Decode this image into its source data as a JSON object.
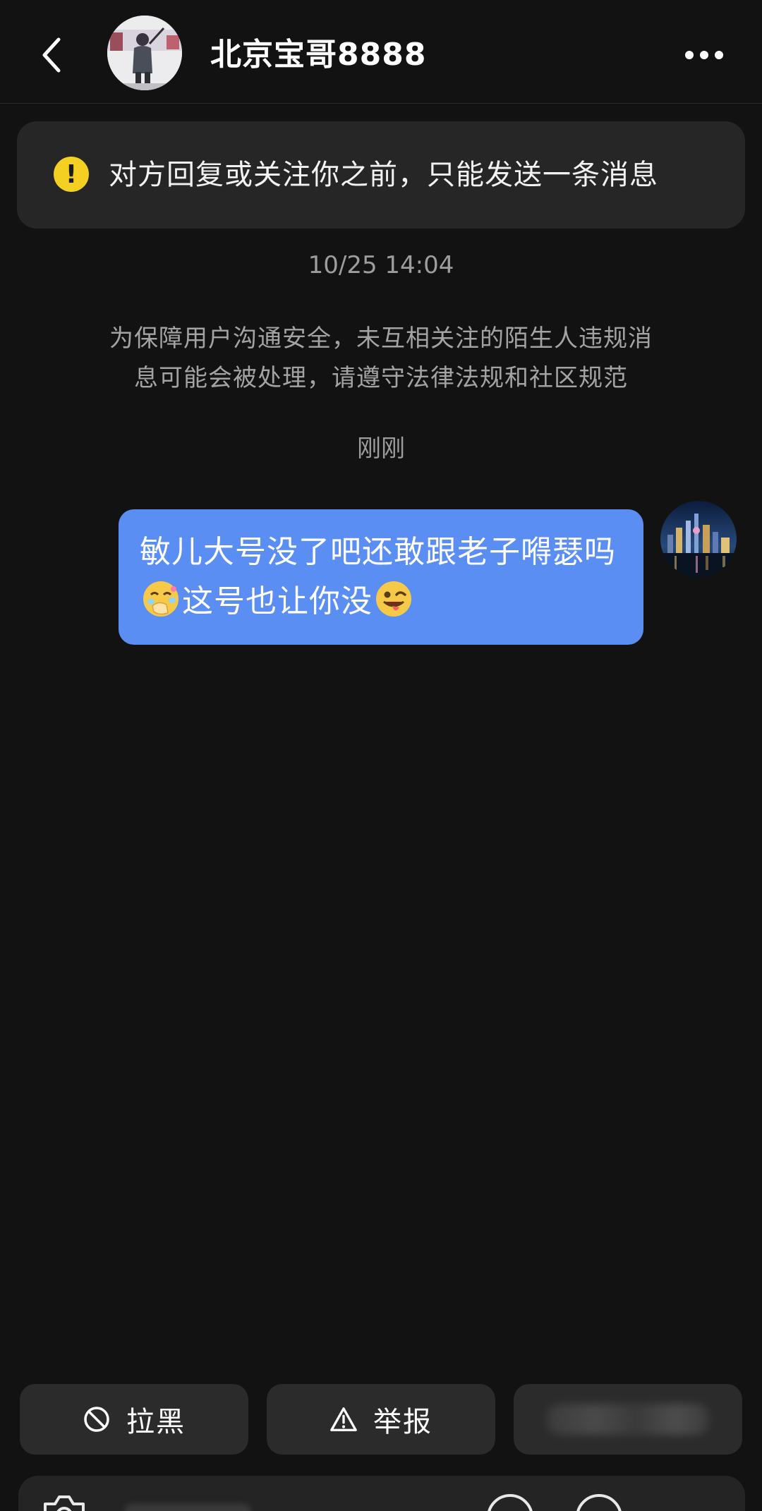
{
  "header": {
    "contact_name": "北京宝哥8888",
    "back_icon": "chevron-left-icon",
    "more_icon": "more-dots-icon"
  },
  "notice": {
    "text": "对方回复或关注你之前，只能发送一条消息",
    "icon": "warning-icon",
    "icon_glyph": "!",
    "icon_color": "#f4d023"
  },
  "chat": {
    "timestamp_1": "10/25 14:04",
    "system_message": "为保障用户沟通安全，未互相关注的陌生人违规消息可能会被处理，请遵守法律法规和社区规范",
    "timestamp_2": "刚刚",
    "message": {
      "text_part1": "敏儿大号没了吧还敢跟老子嘚瑟吗",
      "text_part2": "这号也让你没",
      "emoji_1": "laughing-covering-mouth-emoji",
      "emoji_2": "winking-tongue-emoji",
      "bubble_color": "#5b8ef2"
    }
  },
  "actions": {
    "block_label": "拉黑",
    "block_icon": "block-icon",
    "report_label": "举报",
    "report_icon": "warning-triangle-icon"
  },
  "colors": {
    "background": "#121212",
    "panel": "#262626",
    "button": "#2b2b2b",
    "muted_text": "#a3a3a3"
  }
}
